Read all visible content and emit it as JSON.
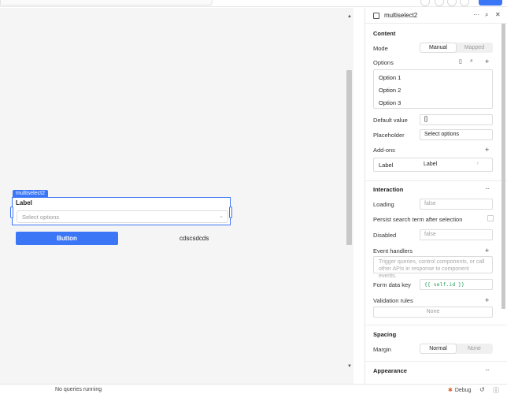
{
  "canvas": {
    "component_tag": "multiselect2",
    "label": "Label",
    "select_placeholder": "Select options",
    "button_label": "Button",
    "text_value": "cdscsdcds"
  },
  "panel": {
    "title": "multiselect2",
    "content": {
      "heading": "Content",
      "mode_label": "Mode",
      "mode_options": [
        "Manual",
        "Mapped"
      ],
      "options_label": "Options",
      "options": [
        "Option 1",
        "Option 2",
        "Option 3"
      ],
      "default_value_label": "Default value",
      "default_value": "[]",
      "placeholder_label": "Placeholder",
      "placeholder_value": "Select options",
      "addons_label": "Add-ons",
      "addon_key": "Label",
      "addon_value": "Label"
    },
    "interaction": {
      "heading": "Interaction",
      "loading_label": "Loading",
      "loading_value": "false",
      "persist_label": "Persist search term after selection",
      "disabled_label": "Disabled",
      "disabled_value": "false",
      "event_handlers_label": "Event handlers",
      "event_handlers_desc": "Trigger queries, control components, or call other APIs in response to component events.",
      "form_key_label": "Form data key",
      "form_key_value": "{{ self.id }}",
      "validation_label": "Validation rules",
      "validation_value": "None"
    },
    "spacing": {
      "heading": "Spacing",
      "margin_label": "Margin",
      "margin_options": [
        "Normal",
        "None"
      ]
    },
    "appearance": {
      "heading": "Appearance"
    }
  },
  "statusbar": {
    "message": "No queries running",
    "debug_label": "Debug"
  }
}
